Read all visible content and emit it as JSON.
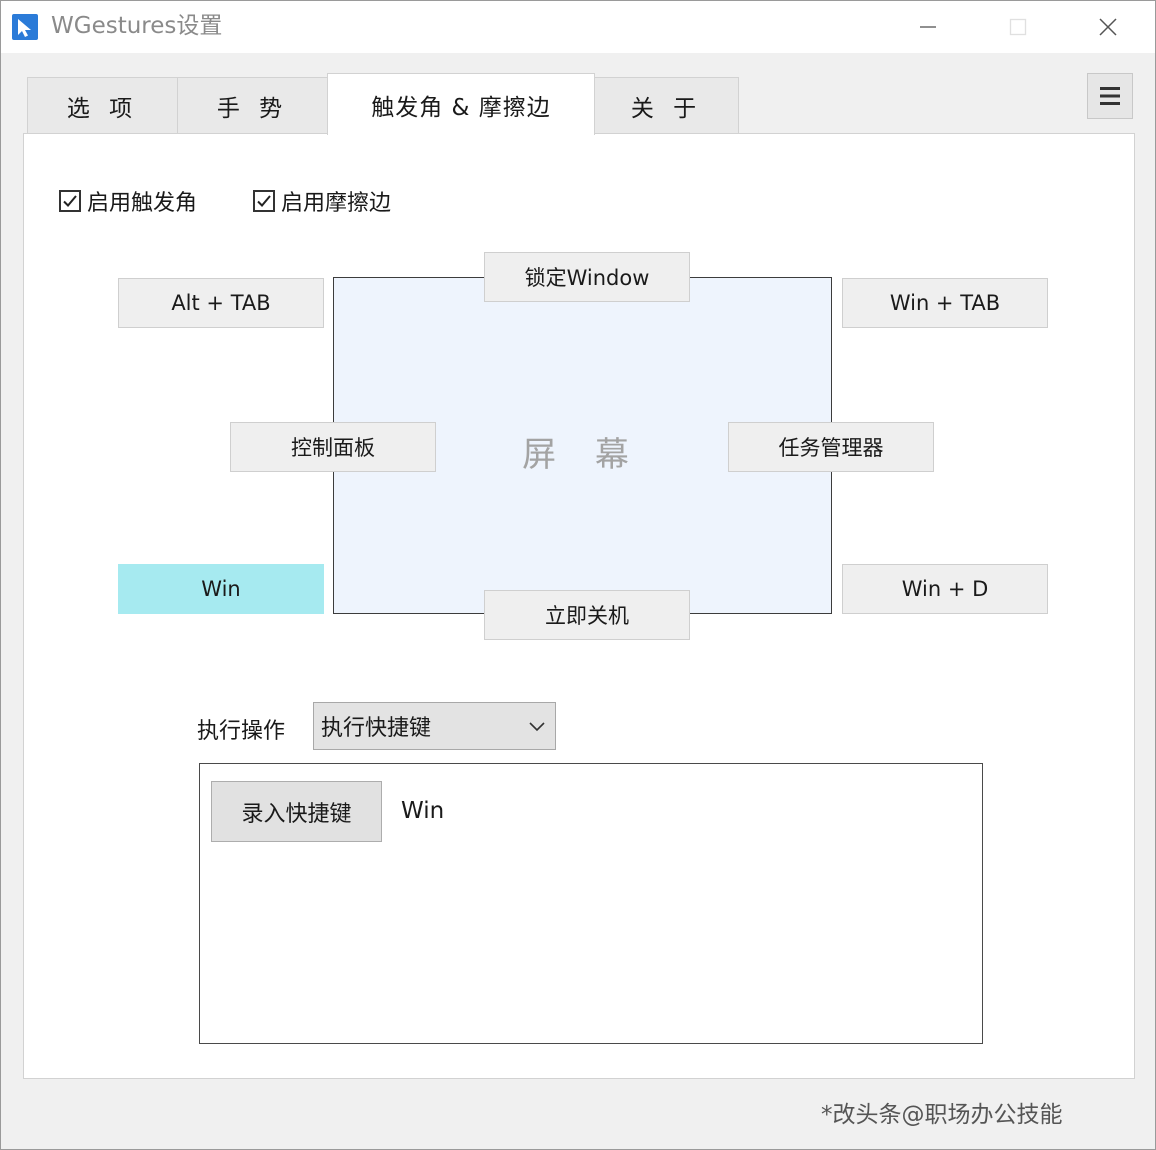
{
  "window": {
    "title": "WGestures设置"
  },
  "tabs": [
    {
      "label": "选 项",
      "active": false
    },
    {
      "label": "手 势",
      "active": false
    },
    {
      "label": "触发角 & 摩擦边",
      "active": true
    },
    {
      "label": "关 于",
      "active": false
    }
  ],
  "options": {
    "enable_corners_label": "启用触发角",
    "enable_corners_checked": true,
    "enable_edges_label": "启用摩擦边",
    "enable_edges_checked": true
  },
  "screen": {
    "label": "屏 幕"
  },
  "corners": {
    "top_left": "Alt + TAB",
    "top_right": "Win + TAB",
    "bottom_left": "Win",
    "bottom_right": "Win + D"
  },
  "edges": {
    "top": "锁定Window",
    "left": "控制面板",
    "right": "任务管理器",
    "bottom": "立即关机"
  },
  "action": {
    "label": "执行操作",
    "selected_option": "执行快捷键",
    "record_button_label": "录入快捷键",
    "hotkey_value": "Win"
  },
  "footer": {
    "note": "*改头条@职场办公技能"
  },
  "colors": {
    "selected_zone": "#a6eaf0",
    "screen_fill": "#eef4fd",
    "app_icon_blue": "#2b7bd8"
  }
}
